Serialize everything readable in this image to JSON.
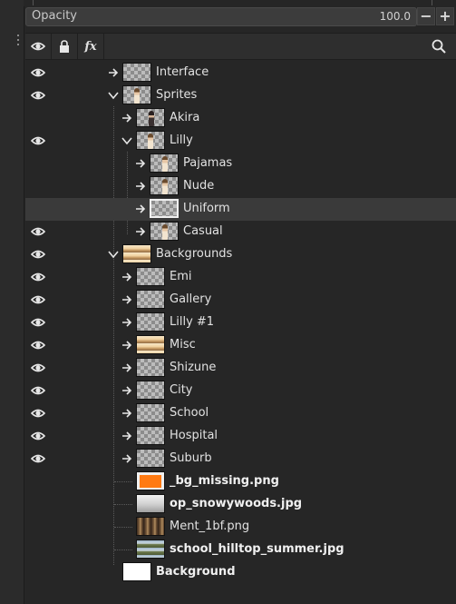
{
  "opacity": {
    "label": "Opacity",
    "value": "100.0",
    "minus": "−",
    "plus": "+"
  },
  "toolbar": {
    "visibility_icon": "eye-icon",
    "lock_icon": "lock-icon",
    "fx_label": "fx",
    "search_icon": "search-icon"
  },
  "layers": [
    {
      "name": "Interface",
      "visible": true,
      "expanded": false,
      "bold": false
    },
    {
      "name": "Sprites",
      "visible": true,
      "expanded": true,
      "bold": false
    },
    {
      "name": "Akira",
      "visible": false,
      "expanded": false,
      "bold": false
    },
    {
      "name": "Lilly",
      "visible": true,
      "expanded": true,
      "bold": false
    },
    {
      "name": "Pajamas",
      "visible": false,
      "expanded": false,
      "bold": false
    },
    {
      "name": "Nude",
      "visible": false,
      "expanded": false,
      "bold": false
    },
    {
      "name": "Uniform",
      "visible": false,
      "expanded": false,
      "bold": false,
      "selected": true
    },
    {
      "name": "Casual",
      "visible": true,
      "expanded": false,
      "bold": false
    },
    {
      "name": "Backgrounds",
      "visible": true,
      "expanded": true,
      "bold": false
    },
    {
      "name": "Emi",
      "visible": true,
      "expanded": false,
      "bold": false
    },
    {
      "name": "Gallery",
      "visible": true,
      "expanded": false,
      "bold": false
    },
    {
      "name": "Lilly #1",
      "visible": true,
      "expanded": false,
      "bold": false
    },
    {
      "name": "Misc",
      "visible": true,
      "expanded": false,
      "bold": false
    },
    {
      "name": "Shizune",
      "visible": true,
      "expanded": false,
      "bold": false
    },
    {
      "name": "City",
      "visible": true,
      "expanded": false,
      "bold": false
    },
    {
      "name": "School",
      "visible": true,
      "expanded": false,
      "bold": false
    },
    {
      "name": "Hospital",
      "visible": true,
      "expanded": false,
      "bold": false
    },
    {
      "name": "Suburb",
      "visible": true,
      "expanded": false,
      "bold": false
    },
    {
      "name": "_bg_missing.png",
      "visible": false,
      "expanded": false,
      "bold": true
    },
    {
      "name": "op_snowywoods.jpg",
      "visible": false,
      "expanded": false,
      "bold": true
    },
    {
      "name": "Ment_1bf.png",
      "visible": false,
      "expanded": false,
      "bold": false
    },
    {
      "name": "school_hilltop_summer.jpg",
      "visible": false,
      "expanded": false,
      "bold": true
    },
    {
      "name": "Background",
      "visible": false,
      "expanded": false,
      "bold": true
    }
  ],
  "colors": {
    "panel_bg": "#262626",
    "selected_row": "#3a3a3a",
    "text": "#e2e2e2",
    "accent_orange": "#ff7a12"
  }
}
